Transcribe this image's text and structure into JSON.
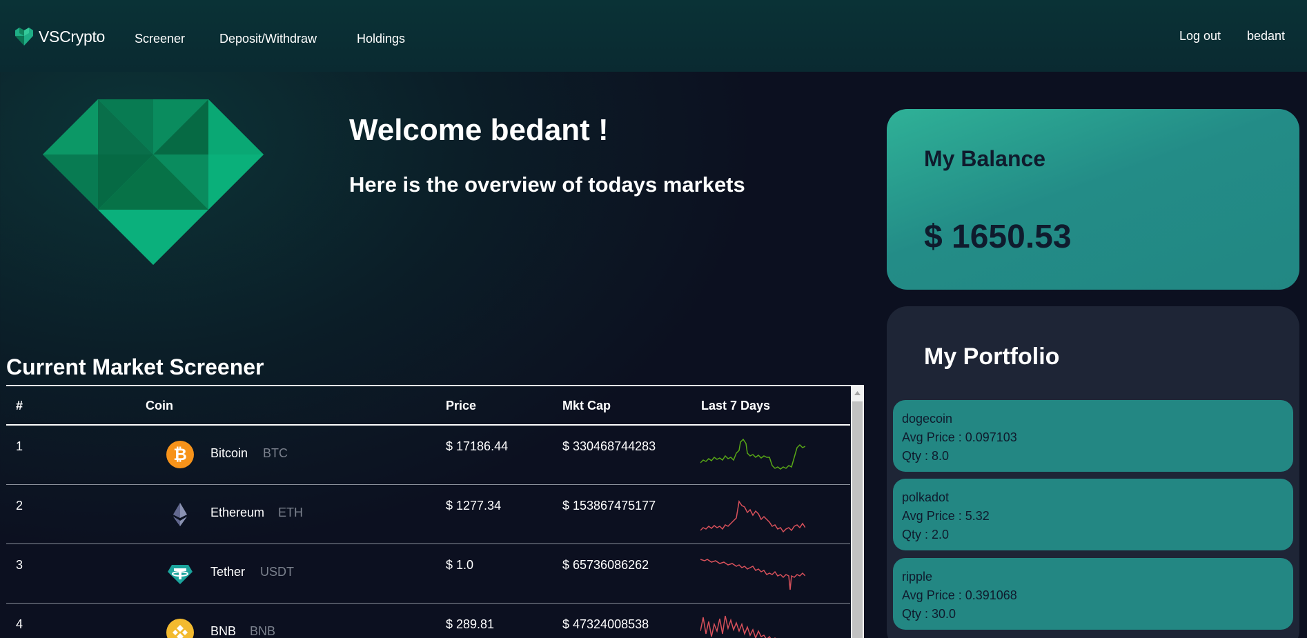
{
  "nav": {
    "brand": "VSCrypto",
    "links": [
      "Screener",
      "Deposit/Withdraw",
      "Holdings"
    ],
    "logout": "Log out",
    "username": "bedant"
  },
  "hero": {
    "welcome": "Welcome bedant !",
    "subtitle": "Here is the overview of todays markets"
  },
  "balance": {
    "title": "My Balance",
    "value": "$ 1650.53"
  },
  "portfolio": {
    "title": "My Portfolio",
    "holdings": [
      {
        "name": "dogecoin",
        "avg": "Avg Price : 0.097103",
        "qty": "Qty : 8.0"
      },
      {
        "name": "polkadot",
        "avg": "Avg Price : 5.32",
        "qty": "Qty : 2.0"
      },
      {
        "name": "ripple",
        "avg": "Avg Price : 0.391068",
        "qty": "Qty : 30.0"
      }
    ]
  },
  "screener": {
    "title": "Current Market Screener",
    "columns": [
      "#",
      "Coin",
      "Price",
      "Mkt Cap",
      "Last 7 Days"
    ],
    "rows": [
      {
        "rank": "1",
        "name": "Bitcoin",
        "symbol": "BTC",
        "price": "$ 17186.44",
        "mktcap": "$ 330468744283",
        "icon": "bitcoin-icon",
        "trend": "up",
        "color": "#58a816"
      },
      {
        "rank": "2",
        "name": "Ethereum",
        "symbol": "ETH",
        "price": "$ 1277.34",
        "mktcap": "$ 153867475177",
        "icon": "ethereum-icon",
        "trend": "down",
        "color": "#d9515b"
      },
      {
        "rank": "3",
        "name": "Tether",
        "symbol": "USDT",
        "price": "$ 1.0",
        "mktcap": "$ 65736086262",
        "icon": "tether-icon",
        "trend": "down",
        "color": "#d9515b"
      },
      {
        "rank": "4",
        "name": "BNB",
        "symbol": "BNB",
        "price": "$ 289.81",
        "mktcap": "$ 47324008538",
        "icon": "bnb-icon",
        "trend": "down",
        "color": "#d9515b"
      }
    ]
  },
  "colors": {
    "accent": "#238783",
    "balance_gradient_start": "#2fb197",
    "card_dark": "#1e2536",
    "positive": "#58a816",
    "negative": "#d9515b"
  }
}
